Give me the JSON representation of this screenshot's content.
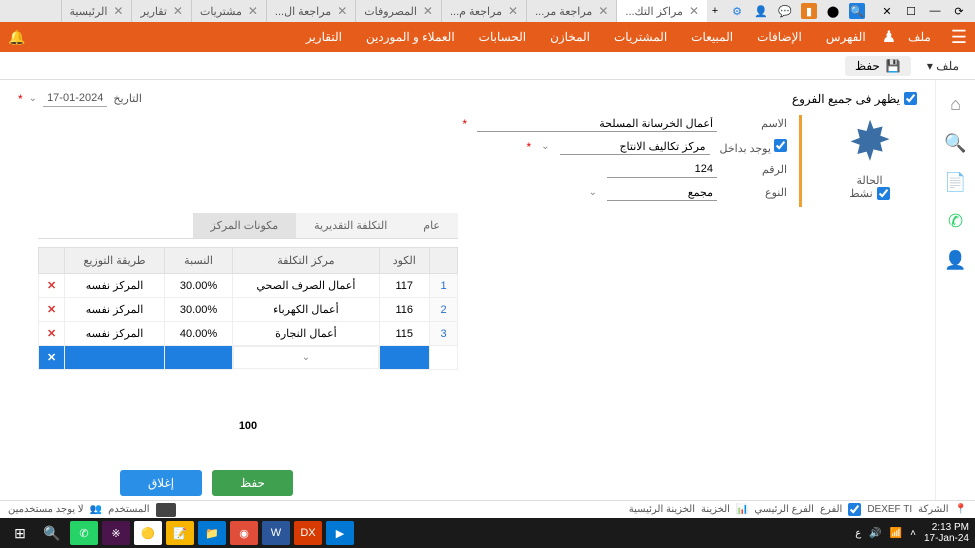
{
  "window": {
    "plus": "+"
  },
  "tabs": [
    {
      "label": "الرئيسية"
    },
    {
      "label": "تقارير"
    },
    {
      "label": "مشتريات"
    },
    {
      "label": "مراجعة ال..."
    },
    {
      "label": "المصروفات"
    },
    {
      "label": "مراجعة م..."
    },
    {
      "label": "مراجعة مر..."
    },
    {
      "label": "مراكز التك...",
      "active": true
    }
  ],
  "nav": {
    "file": "ملف",
    "index": "الفهرس",
    "additions": "الإضافات",
    "sales": "المبيعات",
    "purchases": "المشتريات",
    "stores": "المخازن",
    "accounts": "الحسابات",
    "clients": "العملاء و الموردين",
    "reports": "التقارير"
  },
  "toolbar": {
    "file": "ملف ▾",
    "save": "حفظ"
  },
  "branches": {
    "label": "يظهر فى جميع الفروع"
  },
  "date": {
    "label": "التاريخ",
    "value": "17-01-2024"
  },
  "status": {
    "label": "الحالة",
    "active": "نشط"
  },
  "form": {
    "name_label": "الاسم",
    "name_value": "أعمال الخرسانة المسلحة",
    "inside_label": "يوجد بداخل",
    "inside_value": "مركز تكاليف الانتاج",
    "number_label": "الرقم",
    "number_value": "124",
    "type_label": "النوع",
    "type_value": "مجمع"
  },
  "inner_tabs": {
    "general": "عام",
    "estimate": "التكلفة التقديرية",
    "components": "مكونات المركز"
  },
  "table": {
    "headers": {
      "code": "الكود",
      "center": "مركز التكلفة",
      "ratio": "النسبة",
      "method": "طريقة التوزيع"
    },
    "rows": [
      {
        "idx": "1",
        "code": "117",
        "center": "أعمال الصرف الصحي",
        "ratio": "30.00%",
        "method": "المركز نفسه"
      },
      {
        "idx": "2",
        "code": "116",
        "center": "أعمال الكهرباء",
        "ratio": "30.00%",
        "method": "المركز نفسه"
      },
      {
        "idx": "3",
        "code": "115",
        "center": "أعمال النجارة",
        "ratio": "40.00%",
        "method": "المركز نفسه"
      }
    ],
    "total": "100"
  },
  "actions": {
    "close": "إغلاق",
    "save": "حفظ"
  },
  "statusbar": {
    "company_label": "الشركة",
    "company": "DEXEF TI",
    "branch_label": "الفرع",
    "branch": "الفرع الرئيسي",
    "treasury_label": "الخزينة",
    "treasury": "الخزينة الرئيسية",
    "user_label": "المستخدم",
    "nousers": "لا يوجد مستخدمين"
  },
  "tray": {
    "lang": "ع",
    "time": "2:13 PM",
    "date": "17-Jan-24"
  }
}
